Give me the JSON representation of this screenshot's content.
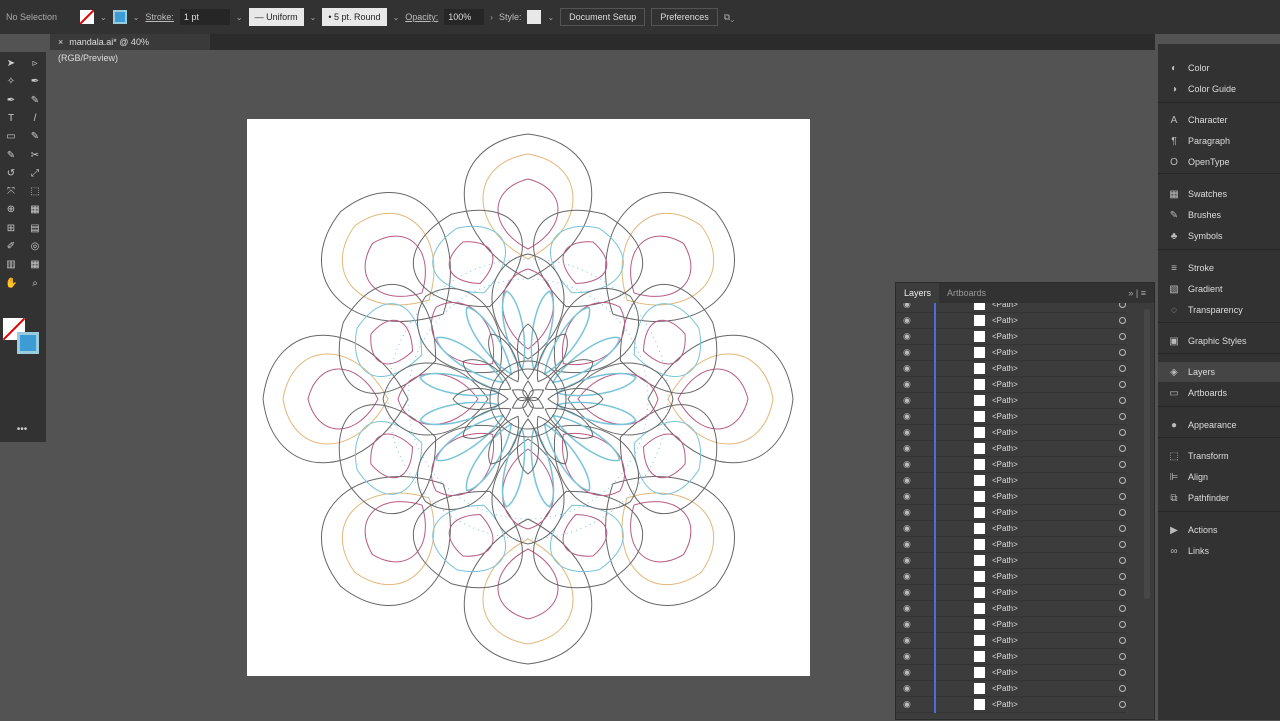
{
  "topbar": {
    "selection": "No Selection",
    "stroke_label": "Stroke:",
    "stroke_weight": "1 pt",
    "stroke_profile": "Uniform",
    "brush": "5 pt. Round",
    "opacity_label": "Opacity:",
    "opacity": "100%",
    "style_label": "Style:",
    "document_setup": "Document Setup",
    "preferences": "Preferences"
  },
  "document": {
    "tab_title": "mandala.ai* @ 40% (RGB/Preview)",
    "close": "×"
  },
  "colors": {
    "outline": "#666666",
    "tan": "#e3b77a",
    "pink": "#b75b84",
    "blue": "#79c4d9",
    "layer_bar": "#4f6be0"
  },
  "layers_panel": {
    "tabs": [
      "Layers",
      "Artboards"
    ],
    "rows": [
      "<Path>",
      "<Path>",
      "<Path>",
      "<Path>",
      "<Path>",
      "<Path>",
      "<Path>",
      "<Path>",
      "<Path>",
      "<Path>",
      "<Path>",
      "<Path>",
      "<Path>",
      "<Path>",
      "<Path>",
      "<Path>",
      "<Path>",
      "<Path>",
      "<Path>",
      "<Path>",
      "<Path>",
      "<Path>",
      "<Path>",
      "<Path>",
      "<Path>",
      "<Path>"
    ]
  },
  "dock": [
    {
      "label": "Color",
      "icon": "color-icon"
    },
    {
      "label": "Color Guide",
      "icon": "color-guide-icon"
    },
    {
      "label": "Character",
      "icon": "character-icon"
    },
    {
      "label": "Paragraph",
      "icon": "paragraph-icon"
    },
    {
      "label": "OpenType",
      "icon": "opentype-icon"
    },
    {
      "label": "Swatches",
      "icon": "swatches-icon"
    },
    {
      "label": "Brushes",
      "icon": "brushes-icon"
    },
    {
      "label": "Symbols",
      "icon": "symbols-icon"
    },
    {
      "label": "Stroke",
      "icon": "stroke-icon"
    },
    {
      "label": "Gradient",
      "icon": "gradient-icon"
    },
    {
      "label": "Transparency",
      "icon": "transparency-icon"
    },
    {
      "label": "Graphic Styles",
      "icon": "graphic-styles-icon"
    },
    {
      "label": "Layers",
      "icon": "layers-icon"
    },
    {
      "label": "Artboards",
      "icon": "artboards-icon"
    },
    {
      "label": "Appearance",
      "icon": "appearance-icon"
    },
    {
      "label": "Transform",
      "icon": "transform-icon"
    },
    {
      "label": "Align",
      "icon": "align-icon"
    },
    {
      "label": "Pathfinder",
      "icon": "pathfinder-icon"
    },
    {
      "label": "Actions",
      "icon": "actions-icon"
    },
    {
      "label": "Links",
      "icon": "links-icon"
    }
  ]
}
